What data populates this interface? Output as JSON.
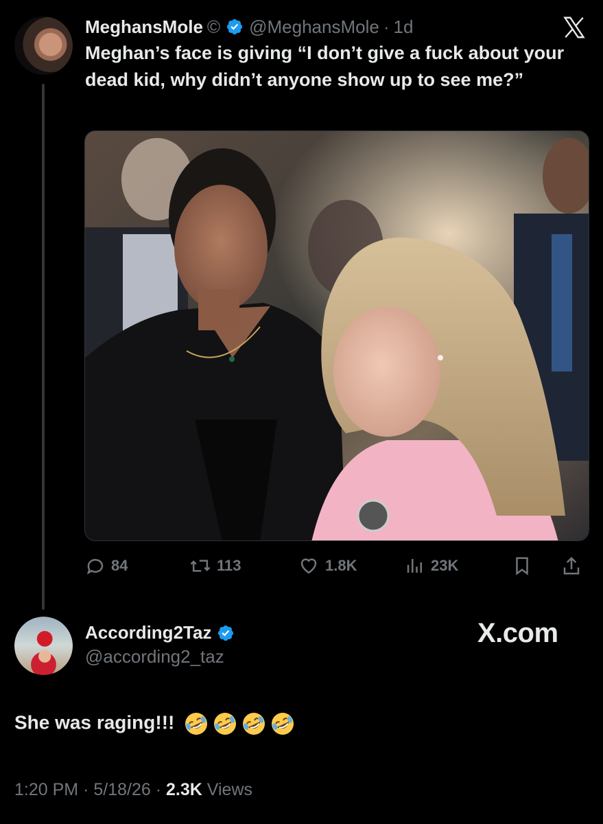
{
  "original_tweet": {
    "display_name": "MeghansMole",
    "copyright_symbol": "©",
    "handle": "@MeghansMole",
    "separator": "·",
    "time_ago": "1d",
    "text": "Meghan’s face is giving “I don’t give a fuck about your dead kid, why didn’t anyone show up to see me?”",
    "stats": {
      "replies": "84",
      "reposts": "113",
      "likes": "1.8K",
      "views": "23K"
    }
  },
  "quote_reply": {
    "display_name": "According2Taz",
    "handle": "@according2_taz",
    "text": "She was raging!!!",
    "emoji": [
      "rolling-on-floor-laughing",
      "rolling-on-floor-laughing",
      "rolling-on-floor-laughing",
      "rolling-on-floor-laughing"
    ],
    "time": "1:20 PM",
    "date": "5/18/26",
    "views_count": "2.3K",
    "views_label": "Views",
    "separator": "·"
  },
  "brand_watermark": "X.com",
  "colors": {
    "background": "#000000",
    "text_primary": "#e7e9ea",
    "text_secondary": "#71767b",
    "verified_blue": "#1d9bf0",
    "thread_line": "#333639"
  },
  "icons": {
    "x_logo": "x-logo-icon",
    "verified": "verified-badge-icon",
    "reply": "reply-icon",
    "repost": "repost-icon",
    "like": "heart-icon",
    "views": "views-icon",
    "bookmark": "bookmark-icon",
    "share": "share-icon"
  }
}
